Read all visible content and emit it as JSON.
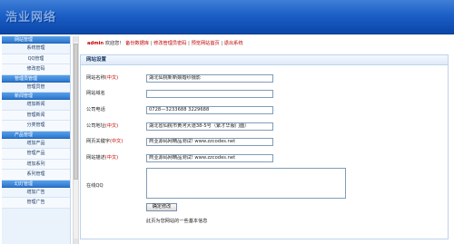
{
  "header": {
    "logo": "浩业网络"
  },
  "sidebar": {
    "groups": [
      {
        "title": "网站管理",
        "items": [
          "系统管理",
          "QQ管理",
          "修改密码"
        ]
      },
      {
        "title": "管理员管理",
        "items": [
          "管理员管"
        ]
      },
      {
        "title": "新闻管理",
        "items": [
          "增加新闻",
          "管理新闻",
          "分类管理"
        ]
      },
      {
        "title": "产品管理",
        "items": [
          "增加产品",
          "管理产品",
          "增加系列",
          "系列管理"
        ]
      },
      {
        "title": "幻灯管理",
        "items": [
          "增加广告",
          "管理广告"
        ]
      }
    ]
  },
  "topbar": {
    "user": "admin",
    "welcome": " 欢迎您！",
    "links": [
      "备份数据库",
      "修改管理员密码",
      "预览网站首页",
      "退出系统"
    ],
    "separator": "|"
  },
  "panel": {
    "title": "网站设置",
    "fields": [
      {
        "label": "网站名称",
        "suffix": "(中文)",
        "value": "湖北仙桃新新娘婚纱摄影"
      },
      {
        "label": "网站域名",
        "suffix": "",
        "value": ""
      },
      {
        "label": "公司电话",
        "suffix": "",
        "value": "0728—3233688 3229688"
      },
      {
        "label": "公司地址",
        "suffix": "(中文)",
        "value": "湖北省仙桃市黄河大道38-5号（紫才华服门面）"
      },
      {
        "label": "网页关键字",
        "suffix": "(中文)",
        "value": "商业源码网精品测试! www.zzcodes.net"
      },
      {
        "label": "网站描述",
        "suffix": "(中文)",
        "value": "商业源码网精品测试! www.zzcodes.net"
      },
      {
        "label": "在线QQ",
        "suffix": "",
        "value": ""
      }
    ],
    "submit_label": "确定修改",
    "note": "此页为您网站的一些基本信息"
  }
}
